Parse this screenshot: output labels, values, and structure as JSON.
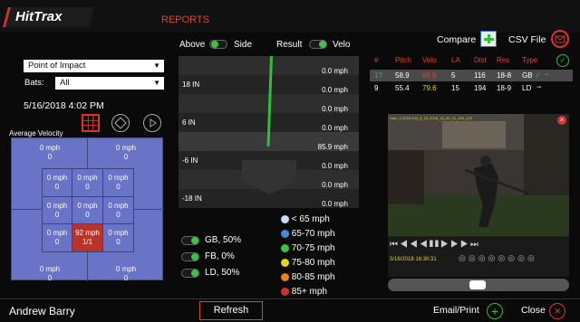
{
  "app": {
    "logo": "HitTrax",
    "section": "REPORTS"
  },
  "left": {
    "filter_select": "Point of Impact",
    "bats_label": "Bats:",
    "bats_value": "All",
    "datetime": "5/16/2018 4:02 PM",
    "chart_label": "Average Velocity",
    "zone": {
      "outer_top_left": [
        "0 mph",
        "0"
      ],
      "outer_top_right": [
        "0 mph",
        "0"
      ],
      "outer_bottom_left": [
        "0 mph",
        "0"
      ],
      "outer_bottom_right": [
        "0 mph",
        "0"
      ],
      "inner": [
        [
          [
            "0 mph",
            "0"
          ],
          [
            "0 mph",
            "0"
          ],
          [
            "0 mph",
            "0"
          ]
        ],
        [
          [
            "0 mph",
            "0"
          ],
          [
            "0 mph",
            "0"
          ],
          [
            "0 mph",
            "0"
          ]
        ],
        [
          [
            "0 mph",
            "0"
          ],
          [
            "92 mph",
            "1/1"
          ],
          [
            "0 mph",
            "0"
          ]
        ]
      ],
      "highlight_color": "#b8332a",
      "zone_color": "#6a74c6"
    }
  },
  "middle": {
    "view_toggle": {
      "left": "Above",
      "right": "Side"
    },
    "mode_toggle": {
      "left": "Result",
      "right": "Velo"
    },
    "rows": [
      {
        "label": "",
        "value": "0.0 mph"
      },
      {
        "label": "18 IN",
        "value": "0.0 mph"
      },
      {
        "label": "",
        "value": "0.0 mph"
      },
      {
        "label": "6 IN",
        "value": "0.0 mph"
      },
      {
        "label": "",
        "value": "85.9 mph"
      },
      {
        "label": "-6 IN",
        "value": "0.0 mph"
      },
      {
        "label": "",
        "value": "0.0 mph"
      },
      {
        "label": "-18 IN",
        "value": "0.0 mph"
      }
    ],
    "batted": [
      {
        "label": "GB, 50%"
      },
      {
        "label": "FB, 0%"
      },
      {
        "label": "LD, 50%"
      }
    ],
    "velo_legend": [
      {
        "label": "< 65 mph",
        "color": "#cfd8ff"
      },
      {
        "label": "65-70 mph",
        "color": "#3d8ad6"
      },
      {
        "label": "70-75 mph",
        "color": "#3cc244"
      },
      {
        "label": "75-80 mph",
        "color": "#e8d41a"
      },
      {
        "label": "80-85 mph",
        "color": "#e8821a"
      },
      {
        "label": "85+ mph",
        "color": "#d32f2f"
      }
    ]
  },
  "right": {
    "compare_label": "Compare",
    "csv_label": "CSV File",
    "headers": [
      "#",
      "Pitch",
      "Velo",
      "LA",
      "Dist",
      "Res",
      "Type"
    ],
    "rows": [
      {
        "num": "1?",
        "pitch": "58.9",
        "velo": "86.9",
        "la": "5",
        "dist": "116",
        "res": "18-8",
        "type": "GB"
      },
      {
        "num": "9",
        "pitch": "55.4",
        "velo": "79.6",
        "la": "15",
        "dist": "194",
        "res": "18-9",
        "type": "LD"
      }
    ],
    "video_caption_top": "Cam_1:2018-143_5_16_2018_16_30_31_403_100",
    "video_timestamp": "5/16/2018 16:30:31"
  },
  "footer": {
    "player": "Andrew Barry",
    "refresh": "Refresh",
    "email": "Email/Print",
    "close": "Close"
  }
}
